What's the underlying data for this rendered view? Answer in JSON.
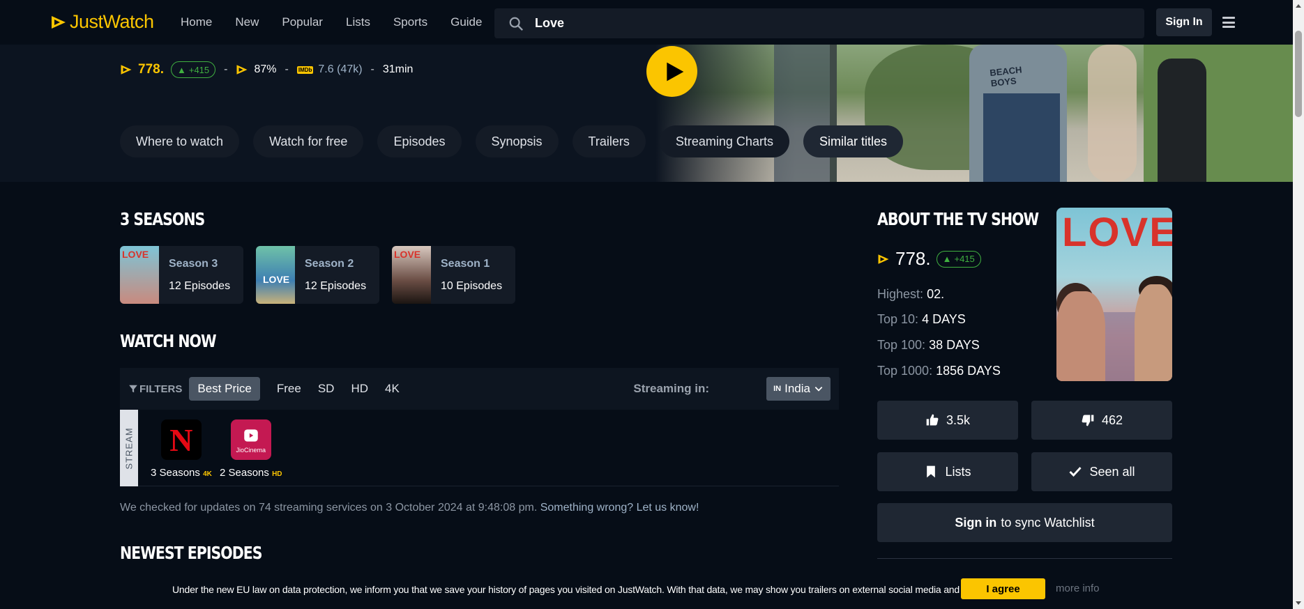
{
  "brand": {
    "name": "JustWatch",
    "accent": "#fbc500"
  },
  "nav": {
    "links": [
      "Home",
      "New",
      "Popular",
      "Lists",
      "Sports",
      "Guide"
    ],
    "search_value": "Love",
    "signin_label": "Sign In"
  },
  "hero": {
    "rank": "778.",
    "trend": "+415",
    "score": "87%",
    "imdb_badge": "IMDb",
    "imdb": "7.6 (47k)",
    "runtime": "31min",
    "sep": "-",
    "poster_text": [
      "BEACH",
      "BOYS"
    ],
    "pills": [
      "Where to watch",
      "Watch for free",
      "Episodes",
      "Synopsis",
      "Trailers",
      "Streaming Charts",
      "Similar titles"
    ]
  },
  "seasons": {
    "heading": "3 SEASONS",
    "items": [
      {
        "title": "Season 3",
        "episodes": "12 Episodes",
        "thumb_text": "LOVE"
      },
      {
        "title": "Season 2",
        "episodes": "12 Episodes",
        "thumb_text": "LOVE"
      },
      {
        "title": "Season 1",
        "episodes": "10 Episodes",
        "thumb_text": "LOVE"
      }
    ]
  },
  "watch_now": {
    "heading": "WATCH NOW",
    "filters_label": "FILTERS",
    "filter_options": [
      "Best Price",
      "Free",
      "SD",
      "HD",
      "4K"
    ],
    "streaming_in_label": "Streaming in:",
    "country_code": "IN",
    "country": "India",
    "row_label": "STREAM",
    "providers": [
      {
        "name": "Netflix",
        "logo_text": "N",
        "seasons": "3 Seasons",
        "quality": "4K"
      },
      {
        "name": "JioCinema",
        "logo_text": "JioCinema",
        "seasons": "2 Seasons",
        "quality": "HD"
      }
    ],
    "checked_text": "We checked for updates on 74 streaming services on 3 October 2024 at 9:48:08 pm.",
    "report_link": "Something wrong? Let us know!"
  },
  "newest": {
    "heading": "NEWEST EPISODES"
  },
  "about": {
    "heading": "ABOUT THE TV SHOW",
    "rank": "778.",
    "trend": "+415",
    "stats": [
      {
        "label": "Highest:",
        "value": "02."
      },
      {
        "label": "Top 10:",
        "value": "4 DAYS"
      },
      {
        "label": "Top 100:",
        "value": "38 DAYS"
      },
      {
        "label": "Top 1000:",
        "value": "1856 DAYS"
      }
    ],
    "poster_title": "LOVE",
    "likes": "3.5k",
    "dislikes": "462",
    "lists_label": "Lists",
    "seen_label": "Seen all",
    "sync_bold": "Sign in",
    "sync_rest": "to sync Watchlist"
  },
  "cookie": {
    "message": "Under the new EU law on data protection, we inform you that we save your history of pages you visited on JustWatch. With that data, we may show you trailers on external social media and video platforms.",
    "agree": "I agree",
    "more": "more info"
  }
}
